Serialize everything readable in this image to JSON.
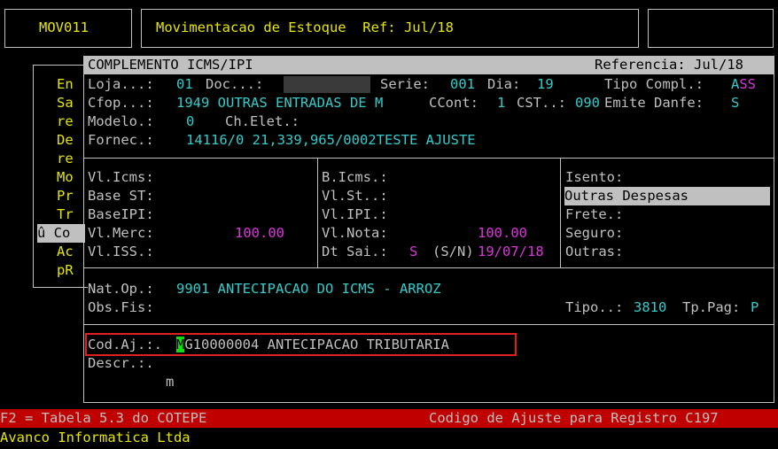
{
  "header": {
    "program_code": "MOV011",
    "screen_title": "Movimentacao de Estoque  Ref: Jul/18"
  },
  "side_menu": {
    "items": [
      "En",
      "Sa",
      "re",
      "De",
      "re",
      "Mo",
      "Pr",
      "Tr",
      "û Co",
      "Ac",
      "pR"
    ],
    "selected_index": 8
  },
  "panel": {
    "title": "COMPLEMENTO ICMS/IPI",
    "reference_label": "Referencia:",
    "reference_value": "Jul/18"
  },
  "fields": {
    "loja_label": "Loja...:",
    "loja_value": "01",
    "doc_label": "Doc...:",
    "serie_label": "Serie:",
    "serie_value": "001",
    "dia_label": "Dia:",
    "dia_value": "19",
    "tipo_compl_label": "Tipo Compl.:",
    "tipo_compl_value_a": "A",
    "tipo_compl_value_b": "SS",
    "cfop_label": "Cfop...:",
    "cfop_value": "1949 OUTRAS ENTRADAS DE M",
    "ccont_label": "CCont:",
    "ccont_value": "1",
    "cst_label": "CST..:",
    "cst_value": "090",
    "emite_danfe_label": "Emite Danfe:",
    "emite_danfe_value": "S",
    "modelo_label": "Modelo.:",
    "modelo_value": "0",
    "ch_elet_label": "Ch.Elet.:",
    "fornec_label": "Fornec.:",
    "fornec_value": "14116/0 21,339,965/0002TESTE AJUSTE"
  },
  "values_grid": {
    "col1": {
      "vl_icms": "Vl.Icms:",
      "base_st": "Base ST:",
      "base_ipi": "BaseIPI:",
      "vl_merc": "Vl.Merc:",
      "vl_merc_value": "100.00",
      "vl_iss": "Vl.ISS.:"
    },
    "col2": {
      "b_icms": "B.Icms.:",
      "vl_st": "Vl.St..:",
      "vl_ipi": "Vl.IPI.:",
      "vl_nota": "Vl.Nota:",
      "vl_nota_value": "100.00",
      "dt_sai": "Dt Sai.:",
      "dt_sai_flag": "S",
      "dt_sai_hint": "(S/N)",
      "dt_sai_date": "19/07/18"
    },
    "col3": {
      "isento": "Isento:",
      "outras_despesas": "Outras Despesas",
      "frete": "Frete.:",
      "seguro": "Seguro:",
      "outras": "Outras:"
    }
  },
  "nat_op": {
    "label": "Nat.Op.:",
    "value": "9901 ANTECIPACAO DO ICMS - ARROZ",
    "obs_label": "Obs.Fis:",
    "tipo_label": "Tipo..:",
    "tipo_value": "3810",
    "tp_pag_label": "Tp.Pag:",
    "tp_pag_value": "P"
  },
  "ajuste": {
    "cod_label": "Cod.Aj.:.",
    "cod_cursor_char": "M",
    "cod_value_rest": "G10000004 ANTECIPACAO TRIBUTARIA",
    "descr_label": "Descr.:.",
    "descr_value": "m"
  },
  "status_bar": {
    "left": "F2 = Tabela 5.3 do COTEPE",
    "right": "Codigo de Ajuste para Registro C197"
  },
  "footer": {
    "company": "Avanco Informatica Ltda"
  },
  "colors": {
    "background": "#000000",
    "label": "#c0c0c0",
    "yellow": "#e6e600",
    "cyan": "#33cccc",
    "magenta": "#dd33dd",
    "status_bar": "#c00000",
    "highlight_box": "#e02020",
    "cursor": "#11dd11"
  }
}
